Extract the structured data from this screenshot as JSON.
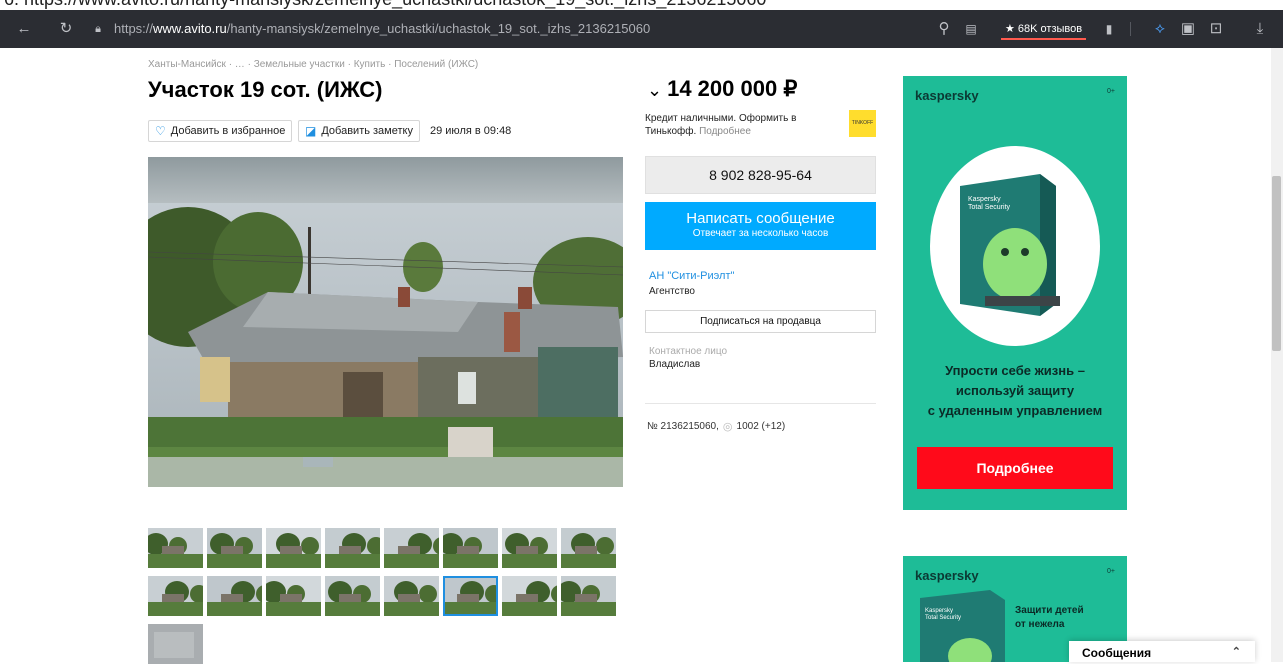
{
  "browser": {
    "url_prefix": "https://",
    "url_host": "www.avito.ru",
    "url_path": "/hanty-mansiysk/zemelnye_uchastki/uchastok_19_sot._izhs_2136215060",
    "top_url_text": "6. https://www.avito.ru/hanty-mansiysk/zemelnye_uchastki/uchastok_19_sot._izhs_2136215060",
    "reviews_label": "★ 68K отзывов"
  },
  "listing": {
    "breadcrumb": "Ханты-Мансийск · … · Земельные участки · Купить · Поселений (ИЖС)",
    "title": "Участок 19 сот. (ИЖС)",
    "favorite_label": "Добавить в избранное",
    "note_label": "Добавить заметку",
    "date": "29 июля в 09:48"
  },
  "sidebar": {
    "price": "14 200 000 ₽",
    "credit_text": "Кредит наличными. Оформить в Тинькофф.",
    "credit_more": "Подробнее",
    "tinkoff_logo": "TINKOFF",
    "phone": "8 902 828-95-64",
    "message_button": "Написать сообщение",
    "message_sub": "Отвечает за несколько часов",
    "seller_name": "АН \"Сити-Риэлт\"",
    "seller_type": "Агентство",
    "subscribe_label": "Подписаться на продавца",
    "contact_label": "Контактное лицо",
    "contact_name": "Владислав",
    "ad_number": "№ 2136215060,",
    "views": "1002 (+12)"
  },
  "ad_banner": {
    "logo": "kaspersky",
    "age": "0+",
    "line1": "Упрости себе жизнь –",
    "line2": "используй защиту",
    "line3": "с удаленным управлением",
    "button": "Подробнее",
    "box_line1": "Kaspersky",
    "box_line2": "Total Security"
  },
  "ad_banner2": {
    "logo": "kaspersky",
    "age": "0+",
    "line1": "Защити детей",
    "line2": "от нежела",
    "box_line1": "Kaspersky",
    "box_line2": "Total Security"
  },
  "messages_bar": {
    "label": "Сообщения"
  },
  "thumbnails": {
    "count": 17,
    "active_index": 13
  }
}
